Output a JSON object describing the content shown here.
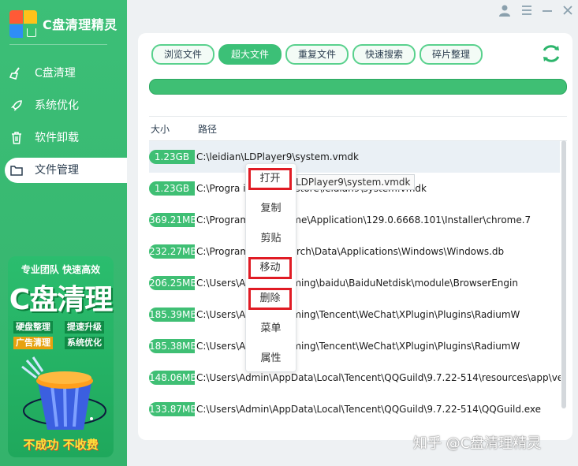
{
  "app": {
    "title": "C盘清理精灵"
  },
  "sidebar": {
    "items": [
      {
        "label": "C盘清理",
        "icon": "broom-icon"
      },
      {
        "label": "系统优化",
        "icon": "rocket-icon"
      },
      {
        "label": "软件卸载",
        "icon": "trash-icon"
      },
      {
        "label": "文件管理",
        "icon": "folder-icon"
      }
    ],
    "active_index": 3
  },
  "promo": {
    "line1": "专业团队  快速高效",
    "headline": "C盘清理",
    "tags": [
      "硬盘整理",
      "提速升级",
      "广告清理",
      "系统优化"
    ],
    "footer": "不成功 不收费"
  },
  "tabs": [
    "浏览文件",
    "超大文件",
    "重复文件",
    "快速搜索",
    "碎片整理"
  ],
  "active_tab": 1,
  "table": {
    "headers": {
      "size": "大小",
      "path": "路径"
    },
    "rows": [
      {
        "size": "1.23GB",
        "path": "C:\\leidian\\LDPlayer9\\system.vmdk"
      },
      {
        "size": "1.23GB",
        "path": "C:\\Progra                  ipason\\appstore\\leidian9\\system.vmdk"
      },
      {
        "size": "369.21MB",
        "path": "C:\\Program               gle\\Chrome\\Application\\129.0.6668.101\\Installer\\chrome.7"
      },
      {
        "size": "232.27MB",
        "path": "C:\\Program               osoft\\Search\\Data\\Applications\\Windows\\Windows.db"
      },
      {
        "size": "206.25MB",
        "path": "C:\\Users\\A              Data\\Roaming\\baidu\\BaiduNetdisk\\module\\BrowserEngin"
      },
      {
        "size": "185.39MB",
        "path": "C:\\Users\\A              Data\\Roaming\\Tencent\\WeChat\\XPlugin\\Plugins\\RadiumW"
      },
      {
        "size": "185.38MB",
        "path": "C:\\Users\\A              Data\\Roaming\\Tencent\\WeChat\\XPlugin\\Plugins\\RadiumW"
      },
      {
        "size": "148.06MB",
        "path": "C:\\Users\\Admin\\AppData\\Local\\Tencent\\QQGuild\\9.7.22-514\\resources\\app\\ve"
      },
      {
        "size": "133.87MB",
        "path": "C:\\Users\\Admin\\AppData\\Local\\Tencent\\QQGuild\\9.7.22-514\\QQGuild.exe"
      }
    ]
  },
  "context_menu": {
    "items": [
      "打开",
      "复制",
      "剪贴",
      "移动",
      "删除",
      "菜单",
      "属性"
    ],
    "highlighted": [
      0,
      3,
      4
    ]
  },
  "tooltip": "LDPlayer9\\system.vmdk",
  "watermark": "知乎 @C盘清理精灵",
  "colors": {
    "accent": "#3cc077",
    "highlight_box": "#e01b24"
  }
}
